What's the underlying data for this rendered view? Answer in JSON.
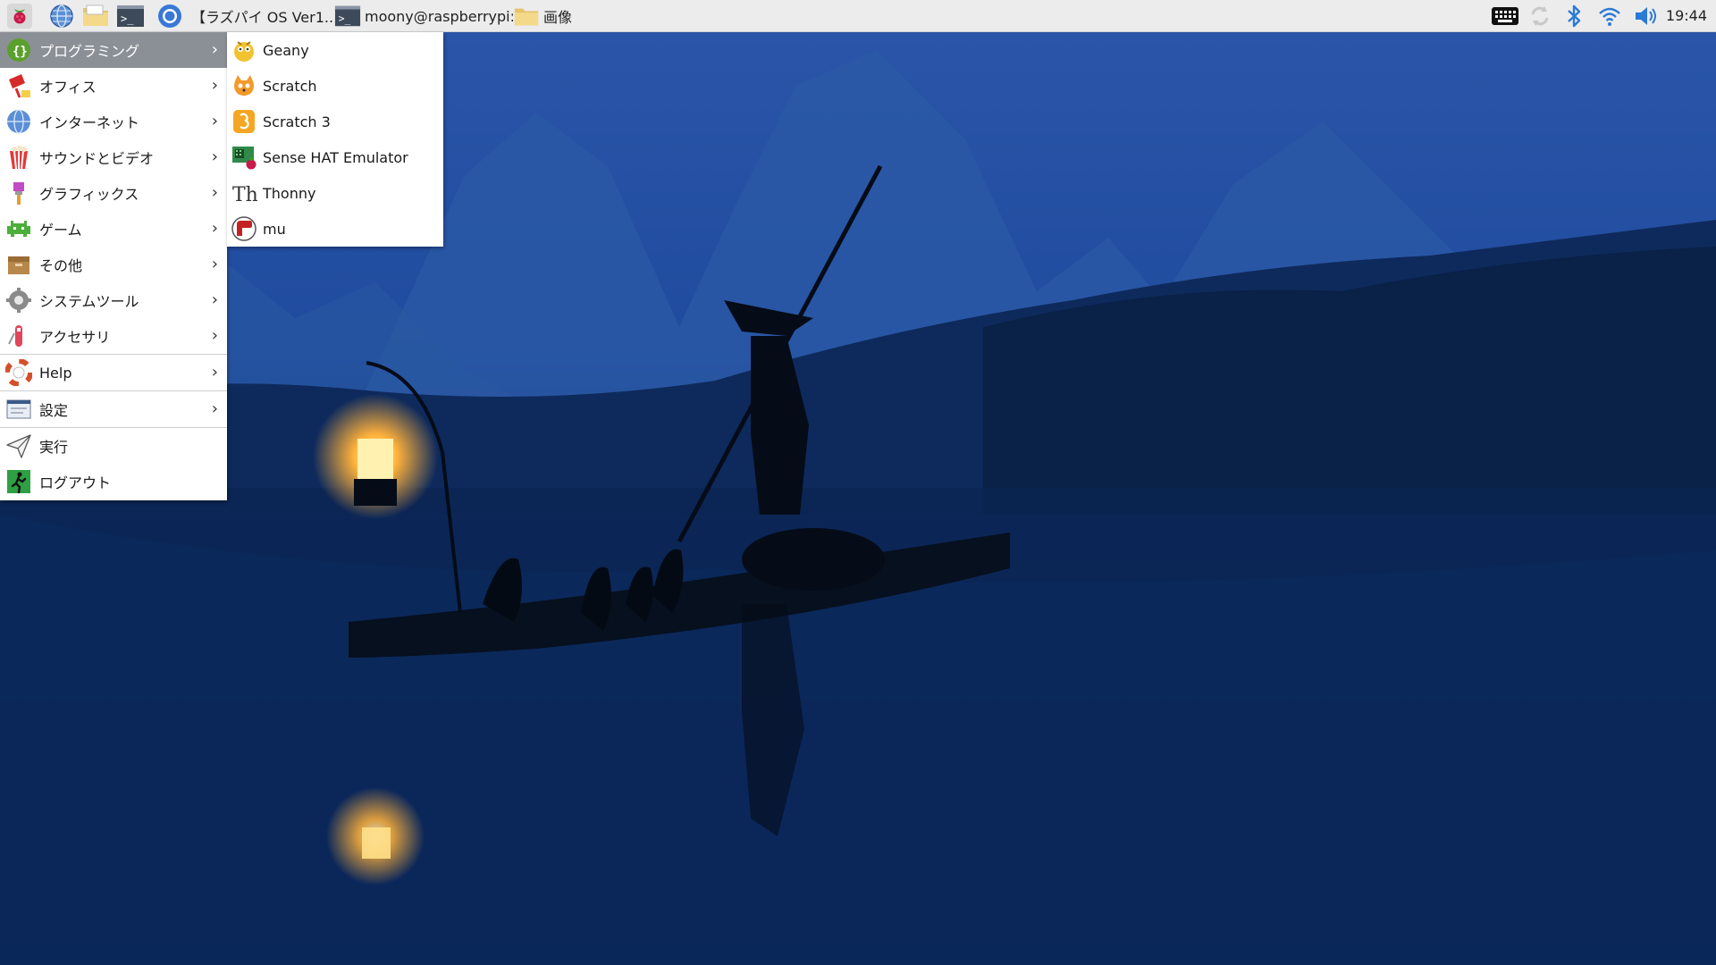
{
  "taskbar": {
    "tasks": [
      {
        "label": "【ラズパイ OS Ver1..",
        "icon": "chromium-icon"
      },
      {
        "label": "moony@raspberrypi: .",
        "icon": "terminal-icon"
      },
      {
        "label": "画像",
        "icon": "folder-icon"
      }
    ],
    "clock": "19:44"
  },
  "main_menu": {
    "items": [
      {
        "label": "プログラミング",
        "icon": "programming-icon",
        "submenu": true,
        "active": true
      },
      {
        "label": "オフィス",
        "icon": "office-icon",
        "submenu": true
      },
      {
        "label": "インターネット",
        "icon": "internet-icon",
        "submenu": true
      },
      {
        "label": "サウンドとビデオ",
        "icon": "sound-video-icon",
        "submenu": true
      },
      {
        "label": "グラフィックス",
        "icon": "graphics-icon",
        "submenu": true
      },
      {
        "label": "ゲーム",
        "icon": "games-icon",
        "submenu": true
      },
      {
        "label": "その他",
        "icon": "other-icon",
        "submenu": true
      },
      {
        "label": "システムツール",
        "icon": "system-tools-icon",
        "submenu": true
      },
      {
        "label": "アクセサリ",
        "icon": "accessories-icon",
        "submenu": true
      },
      {
        "label": "Help",
        "icon": "help-icon",
        "submenu": true
      },
      {
        "label": "設定",
        "icon": "settings-icon",
        "submenu": true
      },
      {
        "label": "実行",
        "icon": "run-icon",
        "submenu": false
      },
      {
        "label": "ログアウト",
        "icon": "logout-icon",
        "submenu": false
      }
    ],
    "arrow": "›"
  },
  "sub_menu": {
    "items": [
      {
        "label": "Geany",
        "icon": "geany-icon"
      },
      {
        "label": "Scratch",
        "icon": "scratch-icon"
      },
      {
        "label": "Scratch 3",
        "icon": "scratch3-icon"
      },
      {
        "label": "Sense HAT Emulator",
        "icon": "sense-hat-icon"
      },
      {
        "label": "Thonny",
        "icon": "thonny-icon"
      },
      {
        "label": "mu",
        "icon": "mu-icon"
      }
    ]
  },
  "colors": {
    "taskbar_bg": "#ececec",
    "menu_active_bg": "#8b9097",
    "wallpaper_top": "#1c3f86",
    "wallpaper_bottom": "#081a3c"
  }
}
